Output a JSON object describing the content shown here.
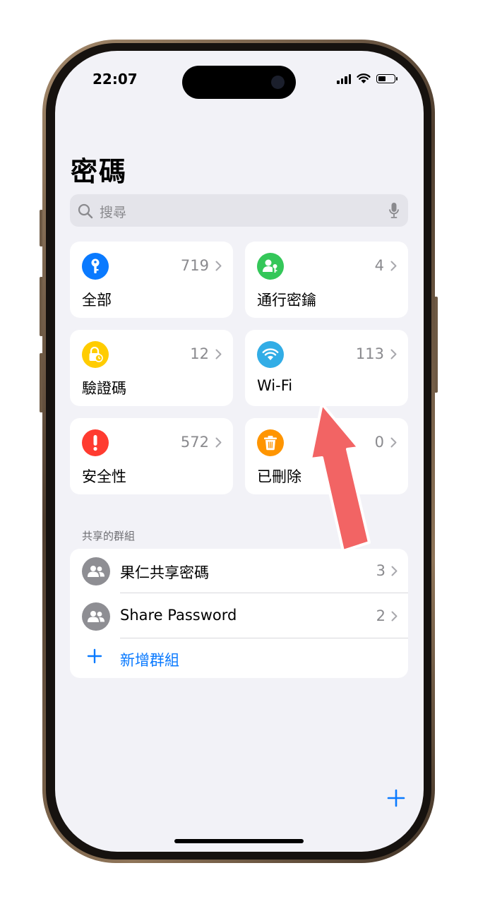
{
  "status_bar": {
    "time": "22:07"
  },
  "header": {
    "title": "密碼"
  },
  "search": {
    "placeholder": "搜尋"
  },
  "categories": [
    {
      "label": "全部",
      "count": "719",
      "color": "#0a7aff",
      "icon": "key-icon"
    },
    {
      "label": "通行密鑰",
      "count": "4",
      "color": "#34c759",
      "icon": "passkey-icon"
    },
    {
      "label": "驗證碼",
      "count": "12",
      "color": "#ffcc00",
      "icon": "lock-clock-icon"
    },
    {
      "label": "Wi-Fi",
      "count": "113",
      "color": "#32ade6",
      "icon": "wifi-icon"
    },
    {
      "label": "安全性",
      "count": "572",
      "color": "#ff3b30",
      "icon": "exclamation-icon"
    },
    {
      "label": "已刪除",
      "count": "0",
      "color": "#ff9500",
      "icon": "trash-icon"
    }
  ],
  "shared_groups": {
    "header": "共享的群組",
    "items": [
      {
        "name": "果仁共享密碼",
        "count": "3",
        "icon": "people-icon"
      },
      {
        "name": "Share Password",
        "count": "2",
        "icon": "people-icon"
      }
    ],
    "add_label": "新增群組"
  },
  "colors": {
    "accent": "#0a7aff",
    "annotation_arrow": "#f26464"
  }
}
